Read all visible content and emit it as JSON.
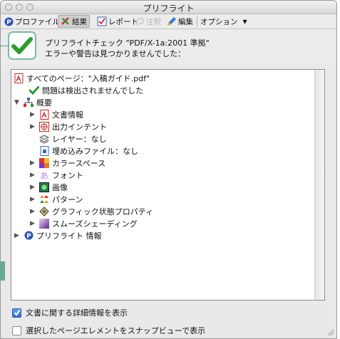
{
  "window": {
    "title": "プリフライト"
  },
  "toolbar": {
    "profile": "プロファイル",
    "results": "結果",
    "report": "レポート",
    "comment": "注釈",
    "edit": "編集",
    "options": "オプション"
  },
  "status": {
    "line1": "プリフライトチェック \"PDF/X-1a:2001 準拠\"",
    "line2": "エラーや警告は見つかりませんでした："
  },
  "tree": {
    "all_pages": "すべてのページ：\"入稿ガイド.pdf\"",
    "no_problems": "問題は検出されませんでした",
    "overview": "概要",
    "doc_info": "文書情報",
    "output_intent": "出力インテント",
    "layers": "レイヤー：なし",
    "embedded_files": "埋め込みファイル：なし",
    "color_spaces": "カラースペース",
    "fonts": "フォント",
    "images": "画像",
    "patterns": "パターン",
    "graphic_state": "グラフィック状態プロパティ",
    "smooth_shading": "スムーズシェーディング",
    "preflight_info": "プリフライト 情報"
  },
  "options": {
    "show_details": "文書に関する詳細情報を表示",
    "show_details_checked": true,
    "snap_view": "選択したページエレメントをスナップビューで表示",
    "snap_view_checked": false
  },
  "colors": {
    "accent_teal": "#69a996",
    "check_green": "#2f9a2f"
  }
}
